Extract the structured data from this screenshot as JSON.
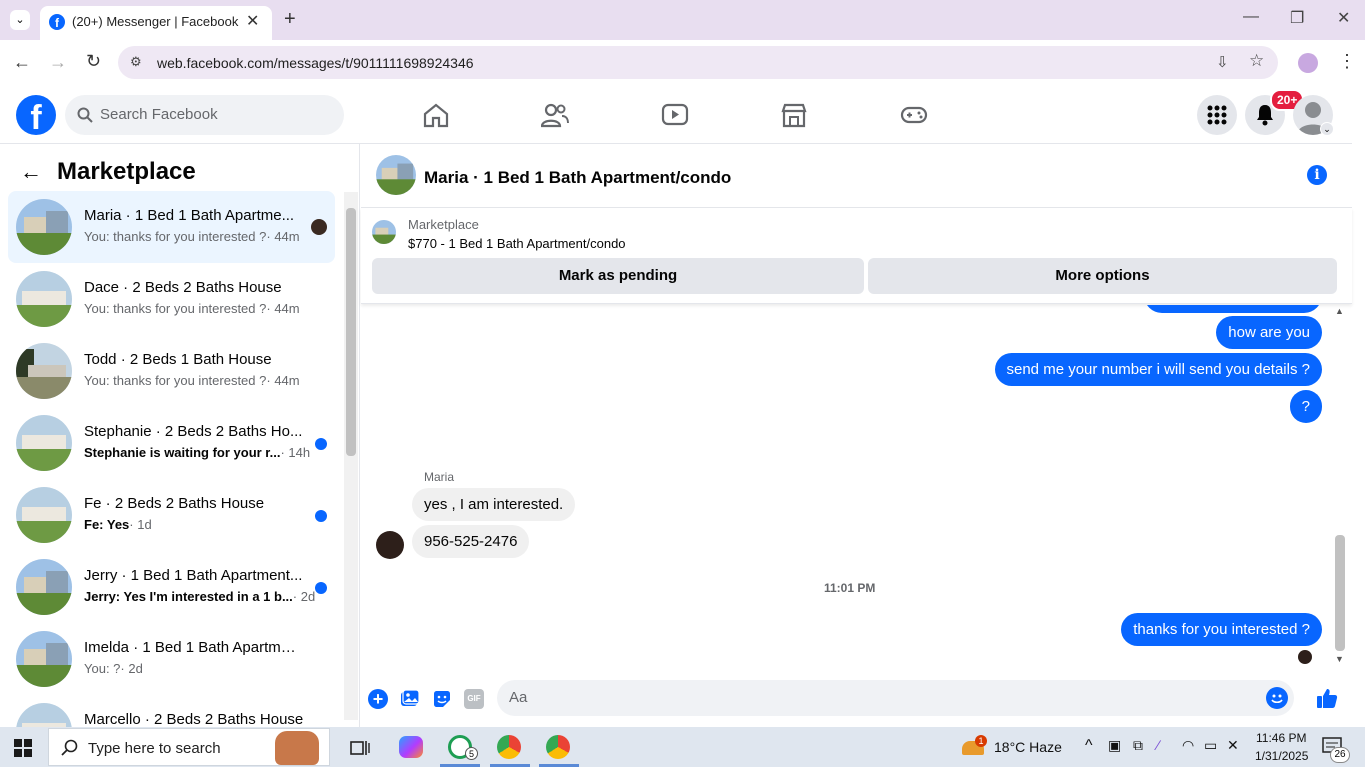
{
  "browser": {
    "tab_title": "(20+) Messenger | Facebook",
    "url": "web.facebook.com/messages/t/9011111698924346"
  },
  "fb": {
    "search_placeholder": "Search Facebook",
    "notification_count": "20+",
    "brand_color": "#0866ff"
  },
  "sidebar": {
    "title": "Marketplace",
    "conversations": [
      {
        "name": "Maria · 1 Bed 1 Bath Apartme...",
        "preview": "You: thanks for you interested ?",
        "time": "· 44m",
        "active": true,
        "unread": false
      },
      {
        "name": "Dace · 2 Beds 2 Baths House",
        "preview": "You: thanks for you interested ?",
        "time": "· 44m",
        "active": false,
        "unread": false
      },
      {
        "name": "Todd · 2 Beds 1 Bath House",
        "preview": "You: thanks for you interested ?",
        "time": "· 44m",
        "active": false,
        "unread": false
      },
      {
        "name": "Stephanie · 2 Beds 2 Baths Ho...",
        "preview": "Stephanie is waiting for your r...",
        "time": "· 14h",
        "active": false,
        "unread": true
      },
      {
        "name": "Fe · 2 Beds 2 Baths House",
        "preview": "Fe: Yes",
        "time": "· 1d",
        "active": false,
        "unread": true
      },
      {
        "name": "Jerry · 1 Bed 1 Bath Apartment...",
        "preview": "Jerry: Yes I'm interested in a 1 b...",
        "time": "· 2d",
        "active": false,
        "unread": true
      },
      {
        "name": "Imelda · 1 Bed 1 Bath Apartment...",
        "preview": "You: ?",
        "time": "· 2d",
        "active": false,
        "unread": false
      },
      {
        "name": "Marcello · 2 Beds 2 Baths House",
        "preview": "",
        "time": "",
        "active": false,
        "unread": false
      }
    ]
  },
  "chat": {
    "title": "Maria · 1 Bed 1 Bath Apartment/condo",
    "listing_label": "Marketplace",
    "listing_price": "$770 - 1 Bed 1 Bath Apartment/condo",
    "mark_pending": "Mark as pending",
    "more_options": "More options",
    "sender_name": "Maria",
    "timestamp": "11:01 PM",
    "messages_out_1": [
      "how are you",
      "send me your number i will send you details ?",
      "?"
    ],
    "messages_in": [
      "yes , I am interested.",
      "956-525-2476"
    ],
    "messages_out_2": [
      "thanks for you interested ?"
    ],
    "composer_placeholder": "Aa",
    "gif_label": "GIF"
  },
  "taskbar": {
    "search_placeholder": "Type here to search",
    "weather": "18°C  Haze",
    "time": "11:46 PM",
    "date": "1/31/2025",
    "notif_count": "26",
    "weather_badge": "1",
    "whatsapp_badge": "5"
  }
}
